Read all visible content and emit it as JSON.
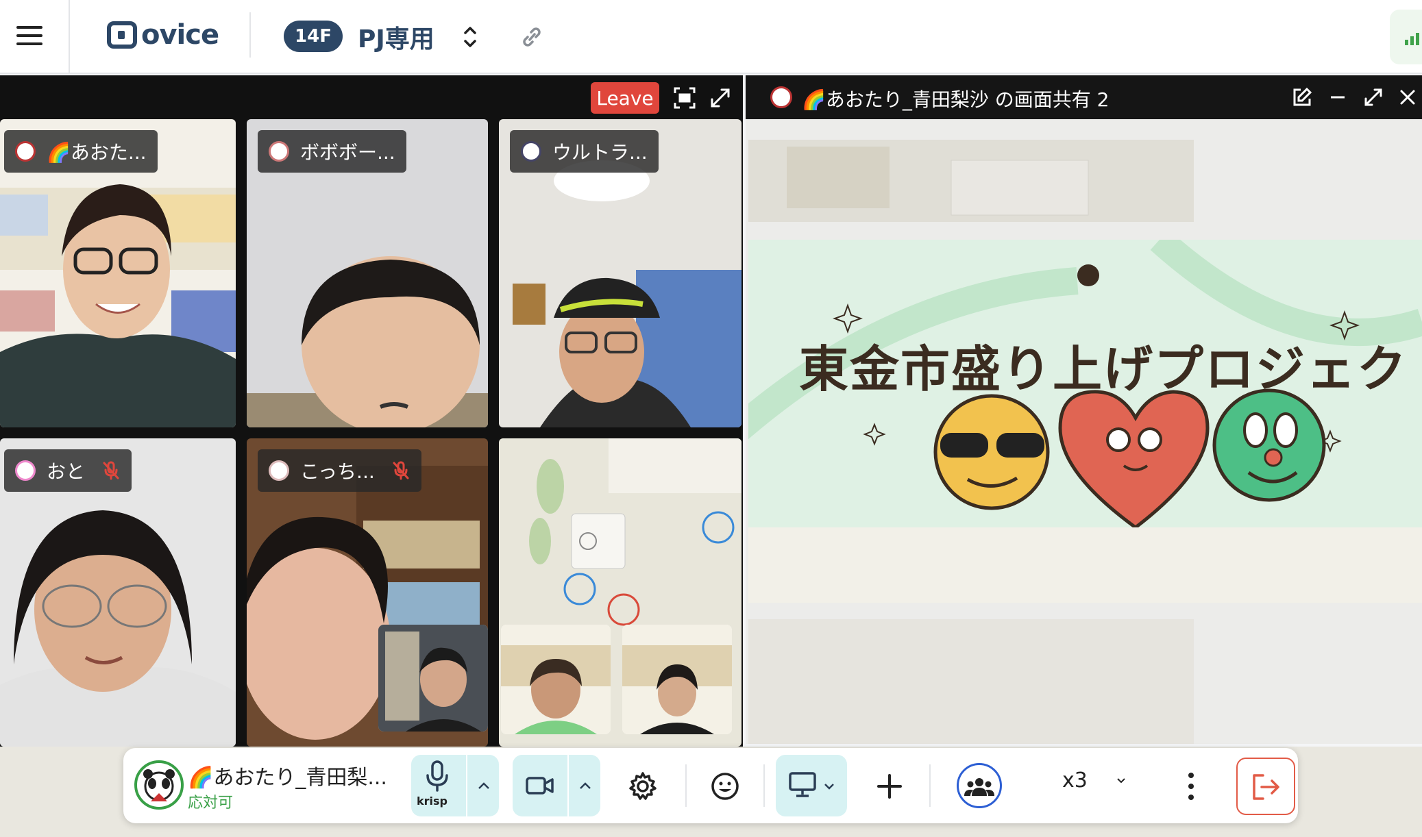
{
  "header": {
    "logo_text": "ovice",
    "floor_badge": "14F",
    "room_name": "PJ専用"
  },
  "video_panel": {
    "leave_label": "Leave",
    "participants": [
      {
        "name": "🌈あおた...",
        "muted": false
      },
      {
        "name": "ボボボー...",
        "muted": false
      },
      {
        "name": "ウルトラ...",
        "muted": false
      },
      {
        "name": "おと",
        "muted": true
      },
      {
        "name": "こっち...",
        "muted": true
      }
    ]
  },
  "share_panel": {
    "title": "🌈あおたり_青田梨沙 の画面共有 2",
    "slide_title": "東金市盛り上げプロジェクト"
  },
  "toolbar": {
    "my_name": "🌈あおたり_青田梨...",
    "my_status": "応対可",
    "noise_cancel_label": "krisp",
    "zoom_label": "x3"
  },
  "colors": {
    "brand_navy": "#2d4766",
    "leave_red": "#e0463c",
    "status_green": "#39a047",
    "toolbar_accent": "#d7f2f3"
  }
}
